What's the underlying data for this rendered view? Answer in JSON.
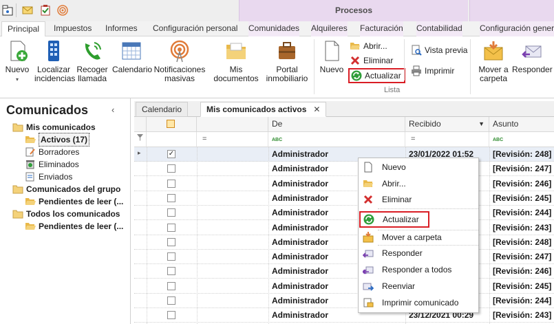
{
  "ribbon_context_group": "Procesos",
  "tabs": [
    "Principal",
    "Impuestos",
    "Informes",
    "Configuración personal",
    "Comunidades",
    "Alquileres",
    "Facturación",
    "Contabilidad",
    "Configuración general"
  ],
  "ribbon": {
    "nuevo": "Nuevo",
    "localizar": "Localizar incidencias",
    "recoger": "Recoger llamada",
    "calendario": "Calendario",
    "notificaciones": "Notificaciones masivas",
    "mis_documentos": "Mis documentos",
    "portal": "Portal inmobiliario",
    "nuevo2": "Nuevo",
    "abrir": "Abrir...",
    "eliminar": "Eliminar",
    "actualizar": "Actualizar",
    "vista_previa": "Vista previa",
    "imprimir": "Imprimir",
    "group_lista": "Lista",
    "mover": "Mover a carpeta",
    "responder": "Responder"
  },
  "left_pane": {
    "title": "Comunicados",
    "collapse": "‹",
    "items": [
      "Mis comunicados",
      "Activos (17)",
      "Borradores",
      "Eliminados",
      "Enviados",
      "Comunicados del grupo",
      "Pendientes de leer (...",
      "Todos los comunicados",
      "Pendientes de leer (..."
    ]
  },
  "doc_tabs": {
    "calendario": "Calendario",
    "activos": "Mis comunicados activos",
    "close": "✕"
  },
  "grid": {
    "headers": {
      "de": "De",
      "recibido": "Recibido",
      "asunto": "Asunto"
    },
    "filter": {
      "eq1": "=",
      "eq2": "=",
      "abc1": "ABC",
      "abc2": "ABC"
    },
    "rows": [
      {
        "de": "Administrador",
        "recibido": "23/01/2022 01:52",
        "asunto": "[Revisión: 248]",
        "checked": true
      },
      {
        "de": "Administrador",
        "recibido": "",
        "asunto": "[Revisión: 247]",
        "checked": false
      },
      {
        "de": "Administrador",
        "recibido": "",
        "asunto": "[Revisión: 246]",
        "checked": false
      },
      {
        "de": "Administrador",
        "recibido": "",
        "asunto": "[Revisión: 245]",
        "checked": false
      },
      {
        "de": "Administrador",
        "recibido": "",
        "asunto": "[Revisión: 244]",
        "checked": false
      },
      {
        "de": "Administrador",
        "recibido": "",
        "asunto": "[Revisión: 243]",
        "checked": false
      },
      {
        "de": "Administrador",
        "recibido": "",
        "asunto": "[Revisión: 248]",
        "checked": false
      },
      {
        "de": "Administrador",
        "recibido": "",
        "asunto": "[Revisión: 247]",
        "checked": false
      },
      {
        "de": "Administrador",
        "recibido": "",
        "asunto": "[Revisión: 246]",
        "checked": false
      },
      {
        "de": "Administrador",
        "recibido": "",
        "asunto": "[Revisión: 245]",
        "checked": false
      },
      {
        "de": "Administrador",
        "recibido": "",
        "asunto": "[Revisión: 244]",
        "checked": false
      },
      {
        "de": "Administrador",
        "recibido": "23/12/2021 00:29",
        "asunto": "[Revisión: 243]",
        "checked": false
      }
    ]
  },
  "context_menu": [
    "Nuevo",
    "Abrir...",
    "Eliminar",
    "Actualizar",
    "Mover a carpeta",
    "Responder",
    "Responder a todos",
    "Reenviar",
    "Imprimir comunicado"
  ],
  "colors": {
    "highlight": "#d91d24",
    "context_tab": "#e9d9ef"
  }
}
